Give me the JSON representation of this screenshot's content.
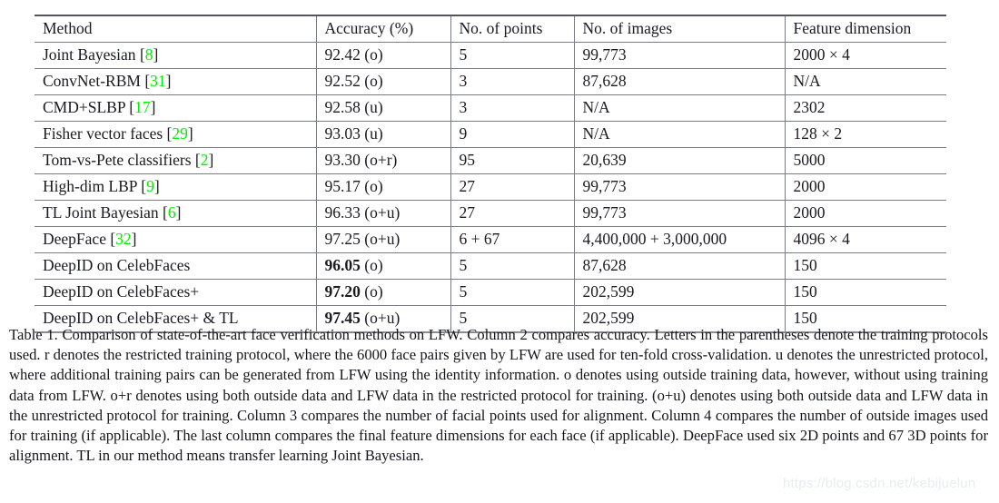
{
  "table": {
    "columns": [
      "Method",
      "Accuracy (%)",
      "No. of points",
      "No. of images",
      "Feature dimension"
    ],
    "rows": [
      {
        "method_text": "Joint Bayesian",
        "method_ref": "8",
        "accuracy_value": "92.42",
        "accuracy_bold": false,
        "accuracy_protocol": "(o)",
        "points": "5",
        "images": "99,773",
        "dimension": "2000 × 4"
      },
      {
        "method_text": "ConvNet-RBM",
        "method_ref": "31",
        "accuracy_value": "92.52",
        "accuracy_bold": false,
        "accuracy_protocol": "(o)",
        "points": "3",
        "images": "87,628",
        "dimension": "N/A"
      },
      {
        "method_text": "CMD+SLBP",
        "method_ref": "17",
        "accuracy_value": "92.58",
        "accuracy_bold": false,
        "accuracy_protocol": "(u)",
        "points": "3",
        "images": "N/A",
        "dimension": "2302"
      },
      {
        "method_text": "Fisher vector faces",
        "method_ref": "29",
        "accuracy_value": "93.03",
        "accuracy_bold": false,
        "accuracy_protocol": "(u)",
        "points": "9",
        "images": "N/A",
        "dimension": "128 × 2"
      },
      {
        "method_text": "Tom-vs-Pete classifiers",
        "method_ref": "2",
        "accuracy_value": "93.30",
        "accuracy_bold": false,
        "accuracy_protocol": "(o+r)",
        "points": "95",
        "images": "20,639",
        "dimension": "5000"
      },
      {
        "method_text": "High-dim LBP",
        "method_ref": "9",
        "accuracy_value": "95.17",
        "accuracy_bold": false,
        "accuracy_protocol": "(o)",
        "points": "27",
        "images": "99,773",
        "dimension": "2000"
      },
      {
        "method_text": "TL Joint Bayesian",
        "method_ref": "6",
        "accuracy_value": "96.33",
        "accuracy_bold": false,
        "accuracy_protocol": "(o+u)",
        "points": "27",
        "images": "99,773",
        "dimension": "2000"
      },
      {
        "method_text": "DeepFace",
        "method_ref": "32",
        "accuracy_value": "97.25",
        "accuracy_bold": false,
        "accuracy_protocol": "(o+u)",
        "points": "6 + 67",
        "images": "4,400,000 + 3,000,000",
        "dimension": "4096 × 4"
      },
      {
        "method_text": "DeepID on CelebFaces",
        "method_ref": "",
        "accuracy_value": "96.05",
        "accuracy_bold": true,
        "accuracy_protocol": "(o)",
        "points": "5",
        "images": "87,628",
        "dimension": "150"
      },
      {
        "method_text": "DeepID on CelebFaces+",
        "method_ref": "",
        "accuracy_value": "97.20",
        "accuracy_bold": true,
        "accuracy_protocol": "(o)",
        "points": "5",
        "images": "202,599",
        "dimension": "150"
      },
      {
        "method_text": "DeepID on CelebFaces+ & TL",
        "method_ref": "",
        "accuracy_value": "97.45",
        "accuracy_bold": true,
        "accuracy_protocol": "(o+u)",
        "points": "5",
        "images": "202,599",
        "dimension": "150"
      }
    ]
  },
  "caption": {
    "text": "Table 1. Comparison of state-of-the-art face verification methods on LFW. Column 2 compares accuracy. Letters in the parentheses denote the training protocols used. r denotes the restricted training protocol, where the 6000 face pairs given by LFW are used for ten-fold cross-validation. u denotes the unrestricted protocol, where additional training pairs can be generated from LFW using the identity information. o denotes using outside training data, however, without using training data from LFW. o+r denotes using both outside data and LFW data in the restricted protocol for training. (o+u) denotes using both outside data and LFW data in the unrestricted protocol for training. Column 3 compares the number of facial points used for alignment. Column 4 compares the number of outside images used for training (if applicable). The last column compares the final feature dimensions for each face (if applicable). DeepFace used six 2D points and 67 3D points for alignment. TL in our method means transfer learning Joint Bayesian."
  },
  "watermark": {
    "text": "https://blog.csdn.net/kebijuelun"
  },
  "colors": {
    "reference_green": "#00ee00",
    "rule": "#7a7c83",
    "thick_rule": "#55565c",
    "text": "#1a1a22",
    "watermark": "#e9ecf1"
  }
}
